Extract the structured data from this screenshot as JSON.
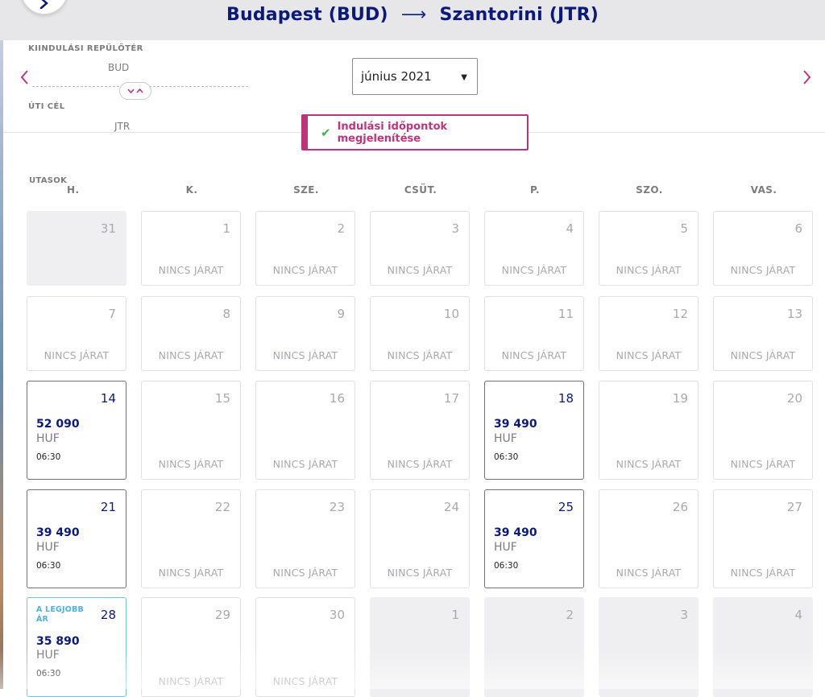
{
  "header": {
    "origin": "Budapest (BUD)",
    "arrow": "⟶",
    "destination": "Szantorini (JTR)"
  },
  "route_panel": {
    "departure_label": "KIINDULÁSI REPÜLŐTÉR",
    "departure_code": "BUD",
    "destination_label": "ÚTI CÉL",
    "destination_code": "JTR"
  },
  "month_select": {
    "value": "június 2021"
  },
  "show_times_button": {
    "label": "Indulási időpontok megjelenítése"
  },
  "passengers_label": "UTASOK",
  "weekdays": [
    "H.",
    "K.",
    "SZE.",
    "CSÜT.",
    "P.",
    "SZO.",
    "VAS."
  ],
  "no_flight_text": "NINCS JÁRAT",
  "currency": "HUF",
  "best_price_tag": "A LEGJOBB ÁR",
  "colors": {
    "brand_navy": "#0b1a7a",
    "accent_magenta": "#c1347a",
    "best_price_blue": "#4bb2e3",
    "check_green": "#3fb34f"
  },
  "calendar": {
    "weeks": [
      [
        {
          "day": "31",
          "state": "outside"
        },
        {
          "day": "1",
          "state": "none"
        },
        {
          "day": "2",
          "state": "none"
        },
        {
          "day": "3",
          "state": "none"
        },
        {
          "day": "4",
          "state": "none"
        },
        {
          "day": "5",
          "state": "none"
        },
        {
          "day": "6",
          "state": "none"
        }
      ],
      [
        {
          "day": "7",
          "state": "none"
        },
        {
          "day": "8",
          "state": "none"
        },
        {
          "day": "9",
          "state": "none"
        },
        {
          "day": "10",
          "state": "none"
        },
        {
          "day": "11",
          "state": "none"
        },
        {
          "day": "12",
          "state": "none"
        },
        {
          "day": "13",
          "state": "none"
        }
      ],
      [
        {
          "day": "14",
          "state": "flight",
          "price": "52 090",
          "time": "06:30"
        },
        {
          "day": "15",
          "state": "none"
        },
        {
          "day": "16",
          "state": "none"
        },
        {
          "day": "17",
          "state": "none"
        },
        {
          "day": "18",
          "state": "flight",
          "price": "39 490",
          "time": "06:30"
        },
        {
          "day": "19",
          "state": "none"
        },
        {
          "day": "20",
          "state": "none"
        }
      ],
      [
        {
          "day": "21",
          "state": "flight",
          "price": "39 490",
          "time": "06:30"
        },
        {
          "day": "22",
          "state": "none"
        },
        {
          "day": "23",
          "state": "none"
        },
        {
          "day": "24",
          "state": "none"
        },
        {
          "day": "25",
          "state": "flight",
          "price": "39 490",
          "time": "06:30"
        },
        {
          "day": "26",
          "state": "none"
        },
        {
          "day": "27",
          "state": "none"
        }
      ],
      [
        {
          "day": "28",
          "state": "best",
          "price": "35 890",
          "time": "06:30"
        },
        {
          "day": "29",
          "state": "none"
        },
        {
          "day": "30",
          "state": "none"
        },
        {
          "day": "1",
          "state": "outside"
        },
        {
          "day": "2",
          "state": "outside"
        },
        {
          "day": "3",
          "state": "outside"
        },
        {
          "day": "4",
          "state": "outside"
        }
      ]
    ]
  }
}
